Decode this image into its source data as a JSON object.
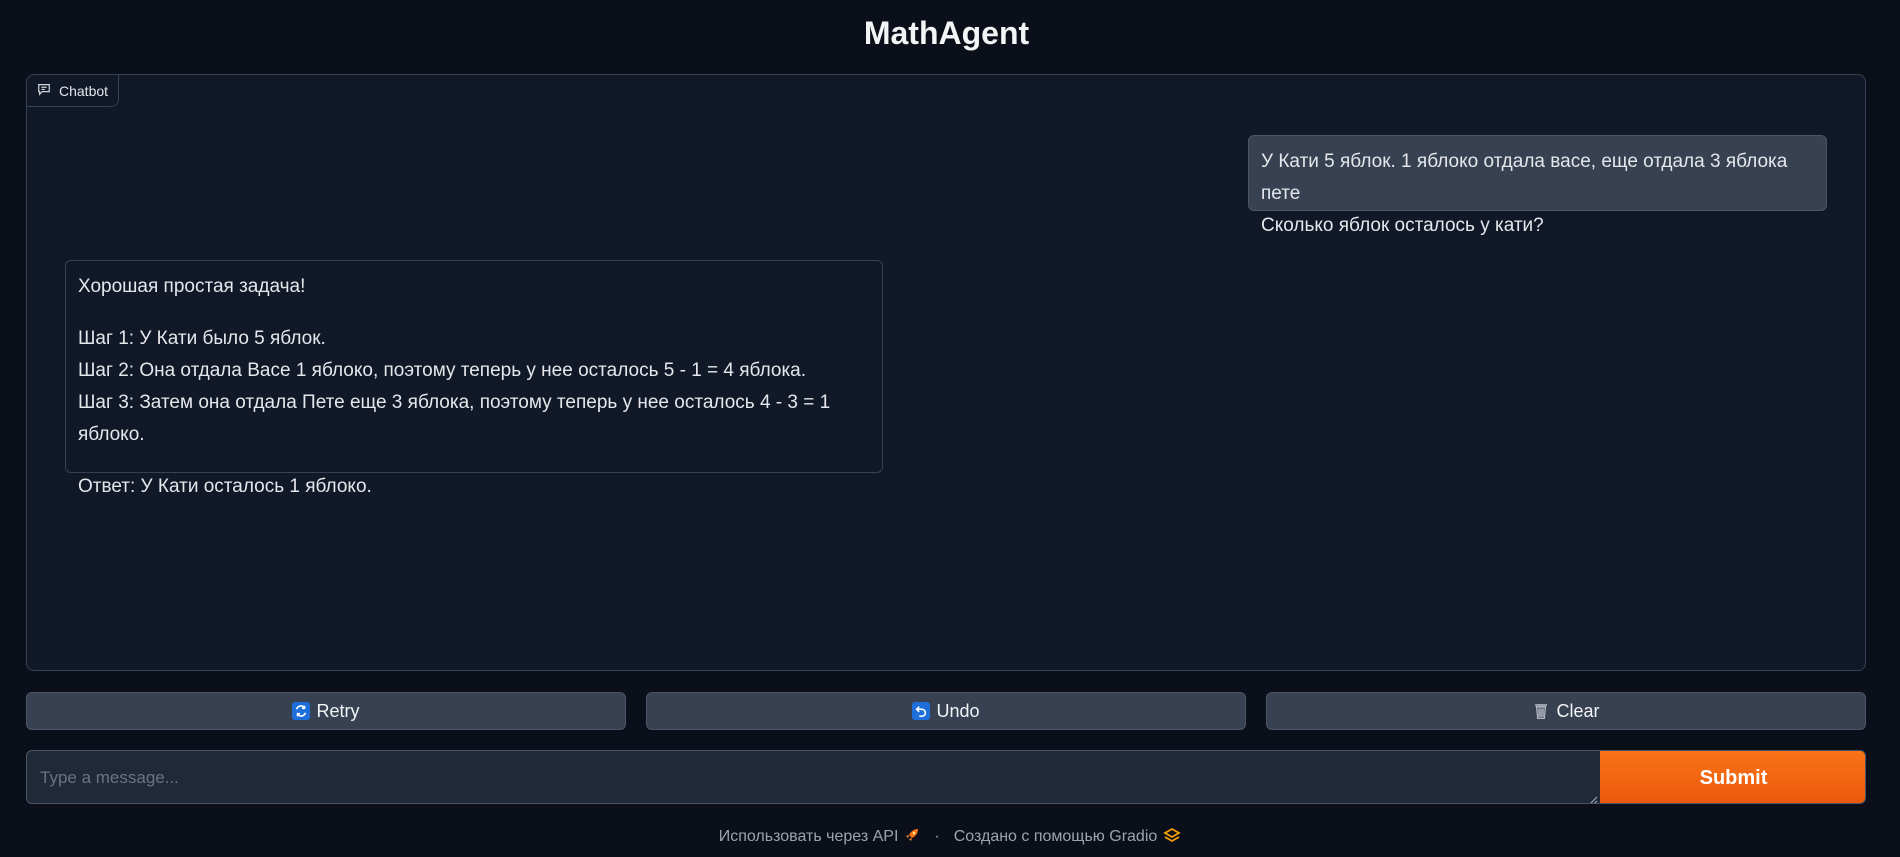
{
  "app": {
    "title": "MathAgent"
  },
  "chatbot": {
    "label": "Chatbot",
    "user_message": {
      "line1": "У Кати 5 яблок. 1 яблоко отдала васе, еще отдала 3 яблока пете",
      "line2": "Сколько яблок осталось у кати?"
    },
    "bot_message": {
      "intro": "Хорошая простая задача!",
      "step1": "Шаг 1: У Кати было 5 яблок.",
      "step2": "Шаг 2: Она отдала Васе 1 яблоко, поэтому теперь у нее осталось 5 - 1 = 4 яблока.",
      "step3": "Шаг 3: Затем она отдала Пете еще 3 яблока, поэтому теперь у нее осталось 4 - 3 = 1 яблоко.",
      "answer": "Ответ: У Кати осталось 1 яблоко."
    }
  },
  "actions": {
    "retry_label": "Retry",
    "undo_label": "Undo",
    "clear_label": "Clear",
    "retry_icon": "retry-icon",
    "undo_icon": "undo-icon",
    "clear_icon": "wastebasket-icon"
  },
  "input": {
    "placeholder": "Type a message...",
    "value": "",
    "submit_label": "Submit"
  },
  "footer": {
    "api_link": "Использовать через API",
    "separator": "·",
    "built_with": "Создано с помощью Gradio"
  },
  "colors": {
    "background": "#0b0f19",
    "panel": "#111827",
    "accent": "#f97316"
  }
}
